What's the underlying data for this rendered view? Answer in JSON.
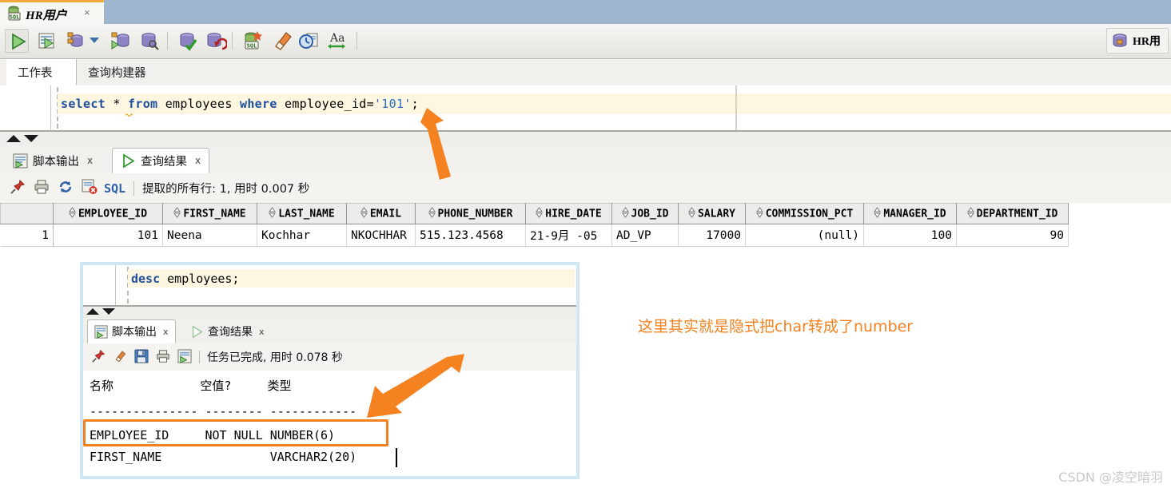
{
  "window": {
    "connection_tab": {
      "label": "HR用户",
      "close": "×",
      "icon": "database-sql-icon"
    },
    "connection_indicator": {
      "label": "HR用",
      "icon": "database-icon"
    }
  },
  "toolbar": {
    "items": [
      {
        "name": "run-statement",
        "icon": "green-play-triangle-icon",
        "selected": true
      },
      {
        "name": "run-script",
        "icon": "run-script-icon",
        "selected": false
      },
      {
        "name": "commit-history",
        "icon": "database-history-icon",
        "selected": false
      },
      {
        "name": "dropdown-caret",
        "icon": "chevron-down-icon",
        "selected": false
      },
      {
        "name": "autotrace",
        "icon": "database-run-icon",
        "selected": false
      },
      {
        "name": "explain-plan",
        "icon": "database-explain-icon",
        "selected": false
      },
      {
        "name": "commit",
        "icon": "database-check-icon",
        "selected": false
      },
      {
        "name": "rollback",
        "icon": "database-undo-icon",
        "selected": false
      },
      {
        "name": "unshared-sql-worksheet",
        "icon": "sql-new-icon",
        "selected": false
      },
      {
        "name": "clear-worksheet",
        "icon": "eraser-icon",
        "selected": false
      },
      {
        "name": "sql-history",
        "icon": "clock-history-icon",
        "selected": false
      },
      {
        "name": "to-upper-lower",
        "icon": "font-case-icon",
        "selected": false
      }
    ]
  },
  "worksheet_tabs": [
    {
      "label": "工作表",
      "active": true
    },
    {
      "label": "查询构建器",
      "active": false
    }
  ],
  "editor": {
    "tokens": [
      {
        "t": "select",
        "c": "kw"
      },
      {
        "t": " ",
        "c": "plain"
      },
      {
        "t": "*",
        "c": "plain"
      },
      {
        "t": " ",
        "c": "plain"
      },
      {
        "t": "from",
        "c": "kw"
      },
      {
        "t": " employees ",
        "c": "plain"
      },
      {
        "t": "where",
        "c": "kw"
      },
      {
        "t": " employee_id=",
        "c": "plain"
      },
      {
        "t": "'101'",
        "c": "lit"
      },
      {
        "t": ";",
        "c": "plain"
      }
    ],
    "full_text": "select * from employees where employee_id='101';"
  },
  "result_tabs": [
    {
      "label": "脚本输出",
      "icon": "script-output-icon",
      "close": "x",
      "active": false
    },
    {
      "label": "查询结果",
      "icon": "green-play-triangle-icon",
      "close": "x",
      "active": true
    }
  ],
  "result_status": {
    "icons": [
      "pin-icon",
      "print-icon",
      "refresh-icon",
      "cancel-icon"
    ],
    "sql_badge": "SQL",
    "text": "提取的所有行: 1, 用时 0.007 秒"
  },
  "grid": {
    "columns": [
      "EMPLOYEE_ID",
      "FIRST_NAME",
      "LAST_NAME",
      "EMAIL",
      "PHONE_NUMBER",
      "HIRE_DATE",
      "JOB_ID",
      "SALARY",
      "COMMISSION_PCT",
      "MANAGER_ID",
      "DEPARTMENT_ID"
    ],
    "rows": [
      {
        "num": "1",
        "cells": [
          "101",
          "Neena",
          "Kochhar",
          "NKOCHHAR",
          "515.123.4568",
          "21-9月 -05",
          "AD_VP",
          "17000",
          "(null)",
          "100",
          "90"
        ]
      }
    ]
  },
  "inset": {
    "editor": {
      "tokens": [
        {
          "t": "desc",
          "c": "kw"
        },
        {
          "t": " employees;",
          "c": "plain"
        }
      ],
      "full_text": "desc employees;"
    },
    "tabs": [
      {
        "label": "脚本输出",
        "icon": "script-output-icon",
        "close": "x",
        "active": true
      },
      {
        "label": "查询结果",
        "icon": "grey-play-triangle-icon",
        "close": "x",
        "active": false
      }
    ],
    "status": {
      "icons": [
        "pin-icon",
        "eraser-icon",
        "save-icon",
        "print-icon",
        "script-output-icon"
      ],
      "text": "任务已完成, 用时 0.078 秒"
    },
    "output_lines": [
      "名称            空值?     类型",
      "--------------- -------- ------------",
      "EMPLOYEE_ID     NOT NULL NUMBER(6)",
      "FIRST_NAME               VARCHAR2(20)"
    ]
  },
  "annotation": {
    "note_text": "这里其实就是隐式把char转成了number",
    "color": "#f58220",
    "arrows": [
      "arrow-to-sql-literal",
      "arrow-to-number-type"
    ],
    "highlight_box_color": "#f08020"
  },
  "watermark": {
    "text": "CSDN @凌空暗羽"
  }
}
